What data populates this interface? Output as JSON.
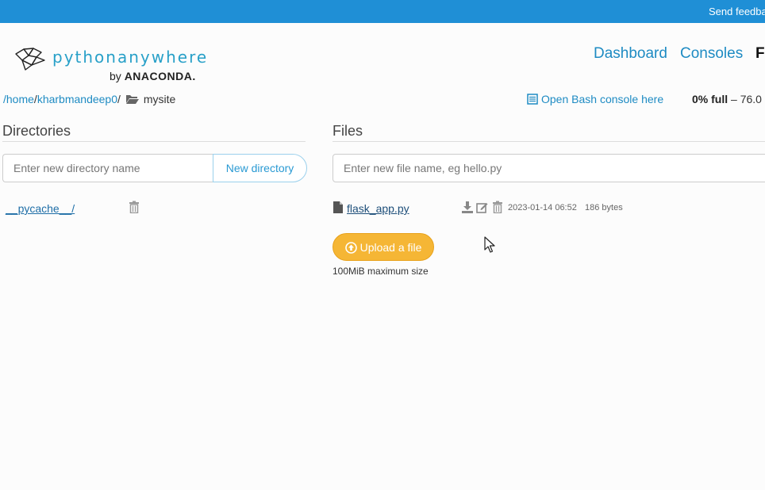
{
  "topbar": {
    "feedback_label": "Send feedba",
    "color": "#1f8fd6"
  },
  "logo": {
    "wordmark": "pythonanywhere",
    "by": "by",
    "company": "ANACONDA."
  },
  "nav": {
    "dashboard": "Dashboard",
    "consoles": "Consoles",
    "files": "F"
  },
  "breadcrumb": {
    "home": "/home",
    "sep1": "/",
    "user": "kharbmandeep0",
    "sep2": "/",
    "current": "mysite"
  },
  "actions": {
    "bash_console": "Open Bash console here"
  },
  "quota": {
    "full": "0% full",
    "rest": " – 76.0"
  },
  "directories": {
    "title": "Directories",
    "new_placeholder": "Enter new directory name",
    "new_button": "New directory",
    "items": [
      {
        "name": "__pycache__/"
      }
    ]
  },
  "files": {
    "title": "Files",
    "new_placeholder": "Enter new file name, eg hello.py",
    "items": [
      {
        "name": "flask_app.py",
        "date": "2023-01-14 06:52",
        "size": "186 bytes"
      }
    ],
    "upload_button": "Upload a file",
    "upload_note": "100MiB maximum size"
  },
  "colors": {
    "accent": "#1e8bc3",
    "upload": "#f5b635"
  }
}
